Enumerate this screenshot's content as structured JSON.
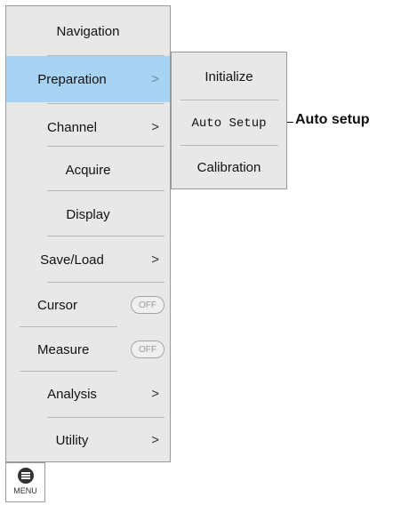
{
  "menu": {
    "items": [
      {
        "label": "Navigation"
      },
      {
        "label": "Preparation",
        "chevron": ">"
      },
      {
        "label": "Channel",
        "chevron": ">"
      },
      {
        "label": "Acquire"
      },
      {
        "label": "Display"
      },
      {
        "label": "Save/Load",
        "chevron": ">"
      },
      {
        "label": "Cursor",
        "toggle": "OFF"
      },
      {
        "label": "Measure",
        "toggle": "OFF"
      },
      {
        "label": "Analysis",
        "chevron": ">"
      },
      {
        "label": "Utility",
        "chevron": ">"
      }
    ],
    "selected": "Preparation",
    "selected_color": "#a9d3f3"
  },
  "submenu": {
    "items": [
      {
        "label": "Initialize"
      },
      {
        "label": "Auto Setup"
      },
      {
        "label": "Calibration"
      }
    ]
  },
  "callout": {
    "label": "Auto setup"
  },
  "menu_button": {
    "label": "MENU",
    "icon": "menu-icon"
  }
}
